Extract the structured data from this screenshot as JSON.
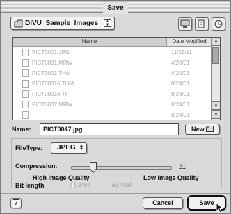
{
  "dialog": {
    "title": "Save"
  },
  "folder_popup": {
    "label": "DIVU_Sample_Images"
  },
  "toolbar": {
    "icons": [
      "desktop-icon",
      "folder-icon",
      "clock-icon"
    ]
  },
  "file_list": {
    "columns": [
      "Name",
      "Date Modified"
    ],
    "rows": [
      {
        "name": "PICT0001.JPG",
        "date": "11/25/11"
      },
      {
        "name": "PICT0001.MRW",
        "date": "4/20/01"
      },
      {
        "name": "PICT0001.THM",
        "date": "4/20/01"
      },
      {
        "name": "PICT00016.THM",
        "date": "8/24/01"
      },
      {
        "name": "PICT00016.TIF",
        "date": "8/24/01"
      },
      {
        "name": "PICT0002.MRW",
        "date": "8/24/01"
      },
      {
        "name": "",
        "date": "8/24/01"
      }
    ]
  },
  "name_field": {
    "label": "Name:",
    "value": "PICT0047.jpg"
  },
  "new_button": {
    "label": "New"
  },
  "options": {
    "filetype_label": "FileType:",
    "filetype_value": "JPEG",
    "compression_label": "Compression:",
    "compression_value": "21",
    "compression_level": 0.2,
    "high_quality_label": "High Image Quality",
    "low_quality_label": "Low Image Quality",
    "bitlength_label": "Bit length",
    "bit_options": [
      {
        "label": "24bit",
        "selected": false
      },
      {
        "label": "48bit",
        "selected": true
      }
    ]
  },
  "footer": {
    "cancel_label": "Cancel",
    "save_label": "Save",
    "help_icon": "help-icon"
  }
}
